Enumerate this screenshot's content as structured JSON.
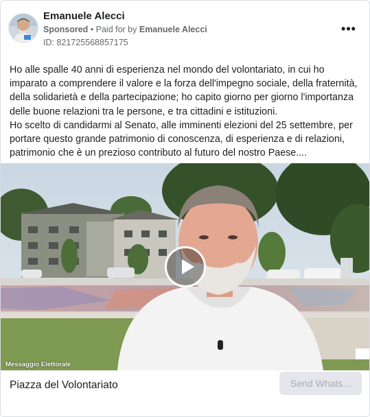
{
  "post": {
    "page_name": "Emanuele Alecci",
    "sponsored_label": "Sponsored",
    "separator": " • ",
    "paid_for_prefix": "Paid for by ",
    "payer_name": "Emanuele Alecci",
    "ad_id": "ID: 821725568857175",
    "more_icon": "more-horizontal-icon",
    "more_label": "•••"
  },
  "body": {
    "paragraph_1": "Ho alle spalle 40 anni di esperienza nel mondo del volontariato, in cui ho imparato a comprendere il valore e la forza dell'impegno sociale, della fraternità, della solidarietà e della partecipazione; ho capito giorno per giorno l'importanza delle buone relazioni tra le persone, e tra cittadini e istituzioni.",
    "paragraph_2": "Ho scelto di candidarmi al Senato, alle imminenti elezioni del 25 settembre, per portare questo grande patrimonio di conoscenza, di esperienza e di relazioni, patrimonio che è un prezioso contributo al futuro del nostro Paese...."
  },
  "media": {
    "type": "video",
    "watermark": "Messaggio Elettorale",
    "play_icon": "play-icon"
  },
  "footer": {
    "link_title": "Piazza del Volontariato",
    "cta_label": "Send Whats..."
  },
  "colors": {
    "text_primary": "#1c1e21",
    "text_secondary": "#65676b",
    "cta_background": "#e4e6eb",
    "cta_text": "#a8abaf",
    "border": "#dadde1"
  }
}
